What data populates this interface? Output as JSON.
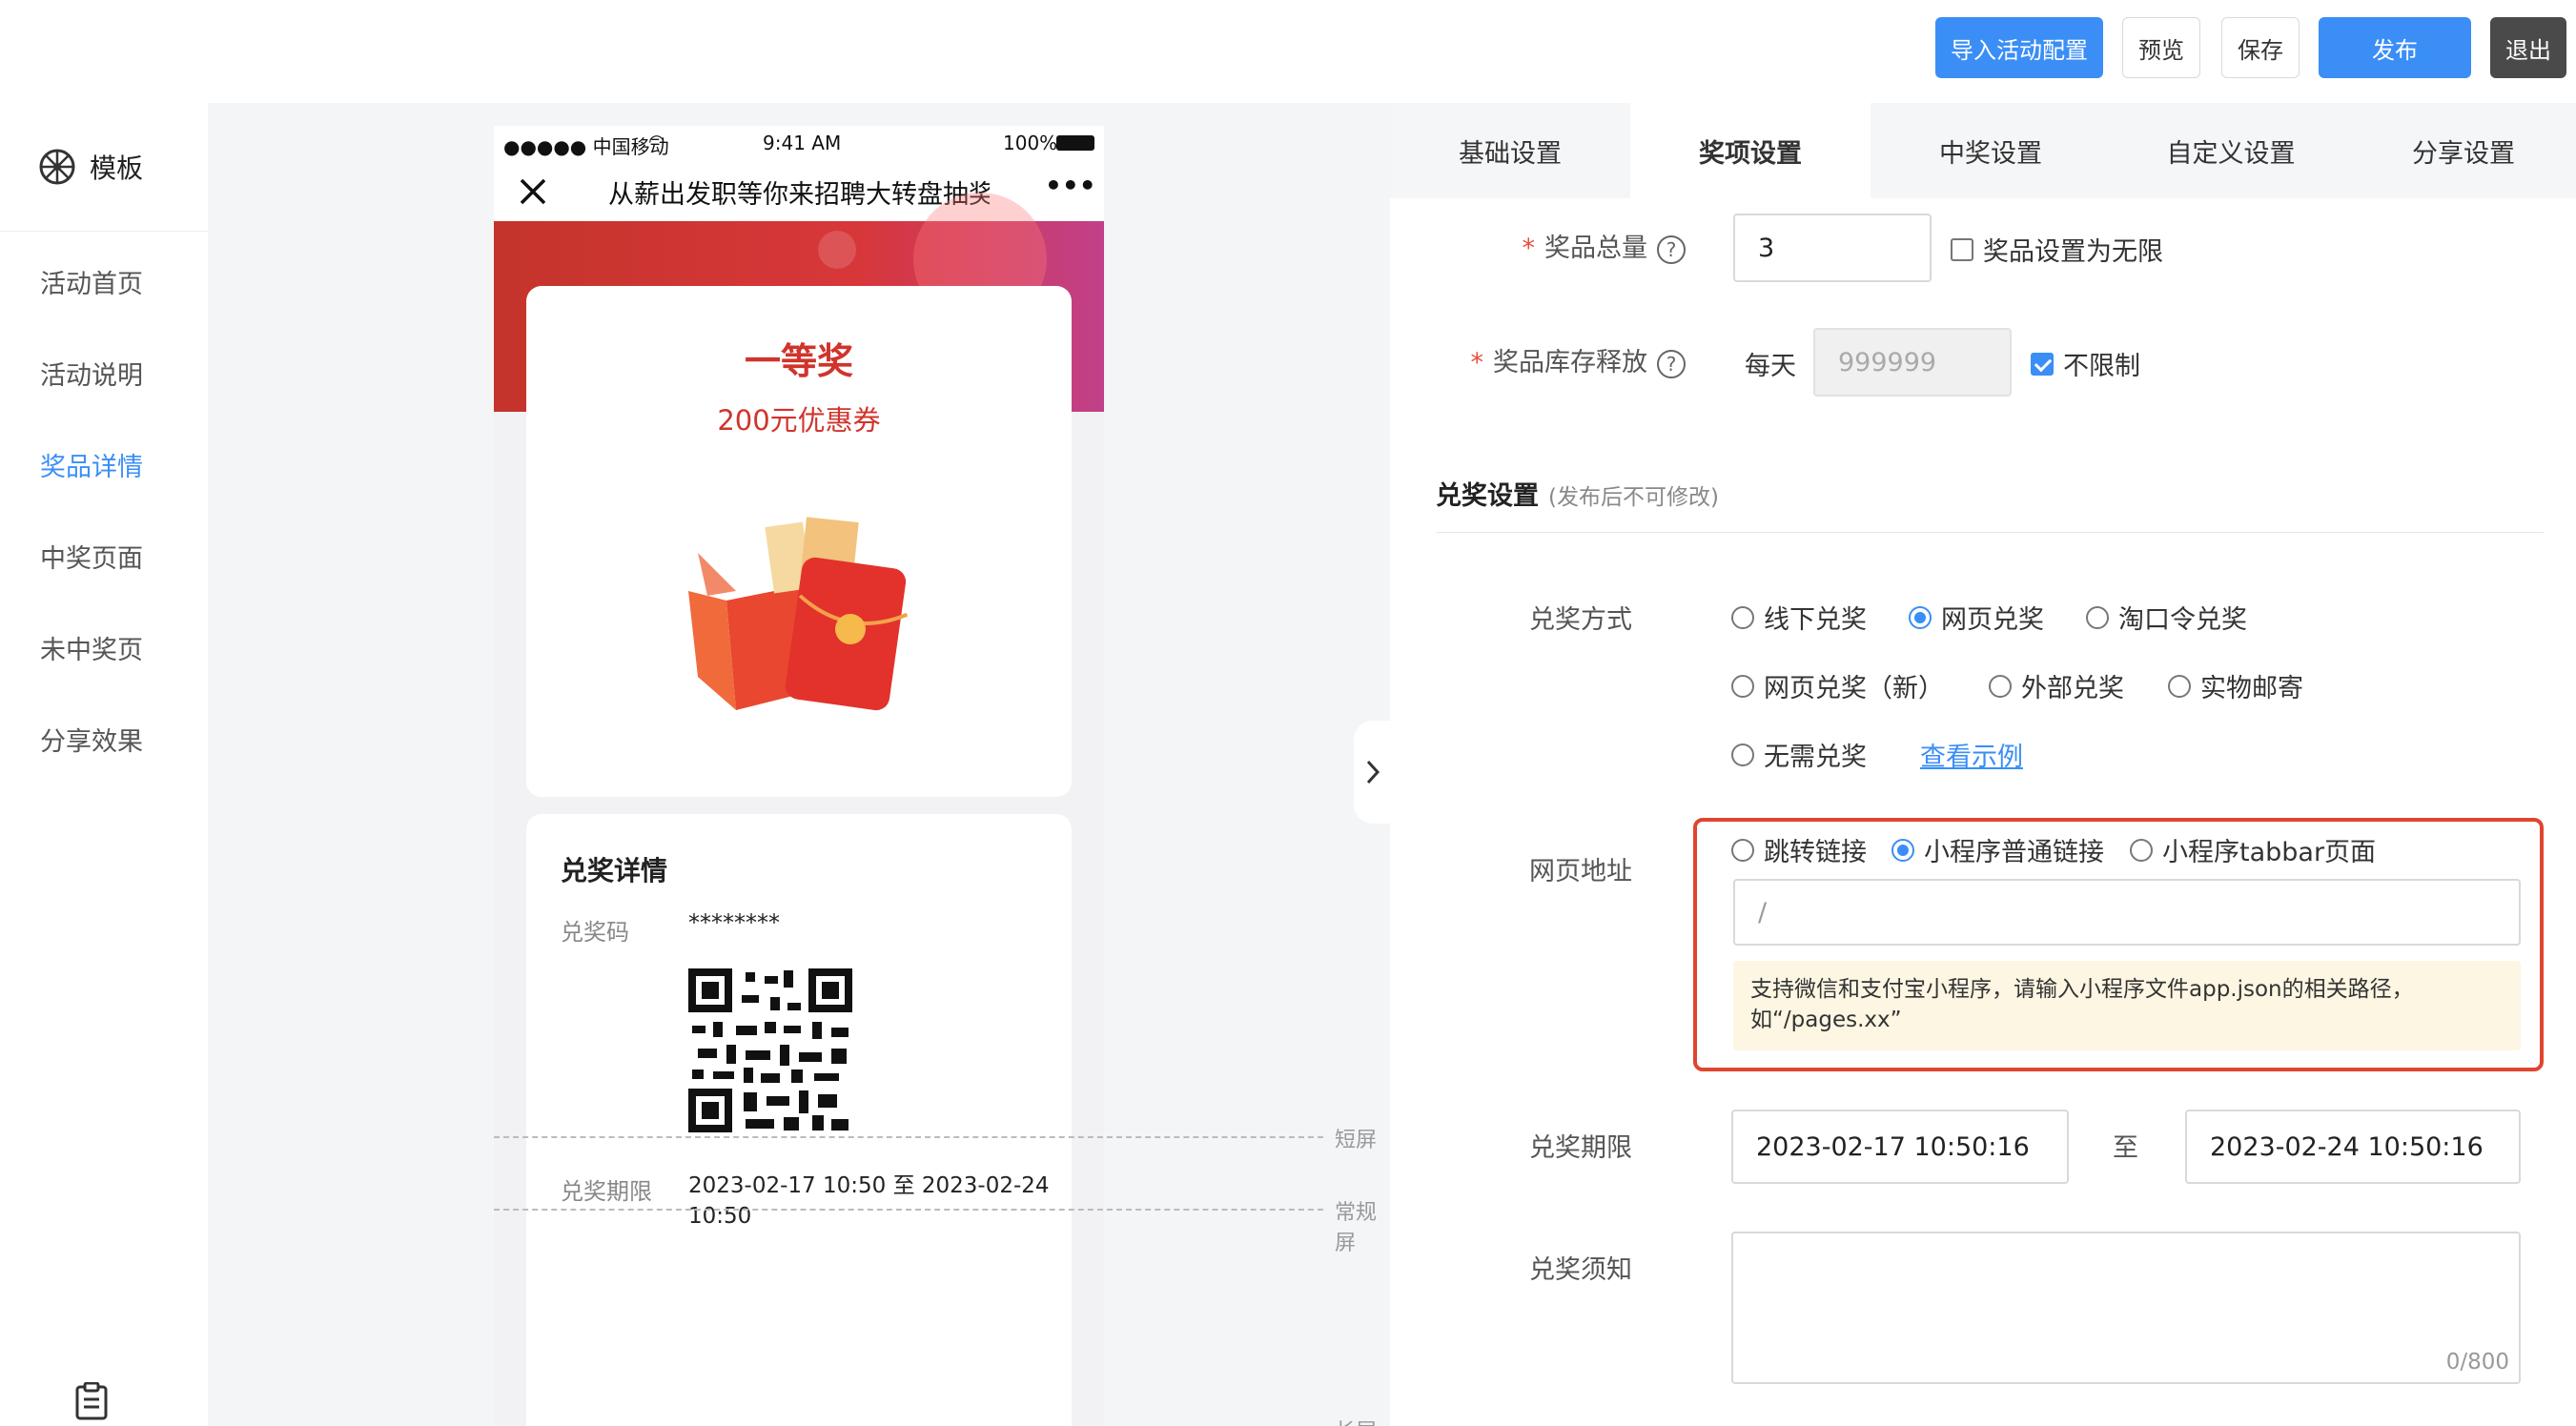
{
  "toolbar": {
    "import_label": "导入活动配置",
    "preview_label": "预览",
    "save_label": "保存",
    "publish_label": "发布",
    "exit_label": "退出"
  },
  "sidebar": {
    "header_label": "模板",
    "items": [
      {
        "label": "活动首页"
      },
      {
        "label": "活动说明"
      },
      {
        "label": "奖品详情"
      },
      {
        "label": "中奖页面"
      },
      {
        "label": "未中奖页"
      },
      {
        "label": "分享效果"
      }
    ],
    "active_index": 2
  },
  "phone": {
    "carrier": "●●●●● 中国移动",
    "time": "9:41 AM",
    "battery": "100%",
    "title": "从薪出发职等你来招聘大转盘抽奖",
    "more": "•••",
    "prize_level": "一等奖",
    "prize_name": "200元优惠券",
    "detail_title": "兑奖详情",
    "code_label": "兑奖码",
    "code_value": "********",
    "period_label": "兑奖期限",
    "period_value": "2023-02-17 10:50 至 2023-02-24 10:50",
    "marker_short": "短屏",
    "marker_normal": "常规屏",
    "marker_long": "长屏"
  },
  "tabs": [
    {
      "label": "基础设置"
    },
    {
      "label": "奖项设置"
    },
    {
      "label": "中奖设置"
    },
    {
      "label": "自定义设置"
    },
    {
      "label": "分享设置"
    }
  ],
  "active_tab": 1,
  "form": {
    "total_label": "奖品总量",
    "total_value": "3",
    "unlimited_label": "奖品设置为无限",
    "unlimited_checked": false,
    "stock_label": "奖品库存释放",
    "per_day_label": "每天",
    "stock_placeholder": "999999",
    "no_limit_label": "不限制",
    "no_limit_checked": true,
    "section_title": "兑奖设置",
    "section_note": "(发布后不可修改)",
    "method_label": "兑奖方式",
    "methods": [
      {
        "label": "线下兑奖",
        "selected": false
      },
      {
        "label": "网页兑奖",
        "selected": true
      },
      {
        "label": "淘口令兑奖",
        "selected": false
      },
      {
        "label": "网页兑奖（新）",
        "selected": false
      },
      {
        "label": "外部兑奖",
        "selected": false
      },
      {
        "label": "实物邮寄",
        "selected": false
      },
      {
        "label": "无需兑奖",
        "selected": false
      }
    ],
    "example_link": "查看示例",
    "url_label": "网页地址",
    "url_types": [
      {
        "label": "跳转链接",
        "selected": false
      },
      {
        "label": "小程序普通链接",
        "selected": true
      },
      {
        "label": "小程序tabbar页面",
        "selected": false
      }
    ],
    "url_value": "/",
    "tip": "支持微信和支付宝小程序，请输入小程序文件app.json的相关路径，如“/pages.xx”",
    "period_label": "兑奖期限",
    "start_date": "2023-02-17 10:50:16",
    "to_label": "至",
    "end_date": "2023-02-24 10:50:16",
    "notice_label": "兑奖须知",
    "notice_counter": "0/800"
  }
}
